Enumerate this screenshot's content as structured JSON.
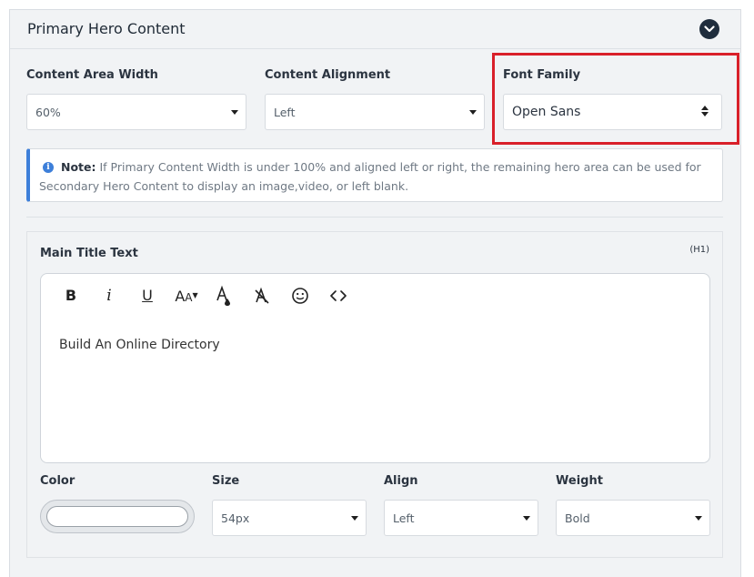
{
  "panel": {
    "title": "Primary Hero Content",
    "collapse_icon": "chevron-down-icon"
  },
  "fields": {
    "content_width": {
      "label": "Content Area Width",
      "value": "60%"
    },
    "content_alignment": {
      "label": "Content Alignment",
      "value": "Left"
    },
    "font_family": {
      "label": "Font Family",
      "value": "Open Sans"
    }
  },
  "note": {
    "label": "Note:",
    "text": "If Primary Content Width is under 100% and aligned left or right, the remaining hero area can be used for Secondary Hero Content to display an image,video, or left blank.",
    "icon": "info-icon",
    "accent": "#3d7fd9"
  },
  "highlight_color": "#d9202a",
  "main_title": {
    "label": "Main Title Text",
    "tag": "(H1)",
    "toolbar": [
      {
        "name": "bold",
        "glyph": "B"
      },
      {
        "name": "italic",
        "glyph": "i"
      },
      {
        "name": "underline",
        "glyph": "U"
      },
      {
        "name": "font-size",
        "glyph": "AA"
      },
      {
        "name": "text-color",
        "glyph": "A"
      },
      {
        "name": "clear-format",
        "glyph": "A"
      },
      {
        "name": "emoji",
        "glyph": "☺"
      },
      {
        "name": "code",
        "glyph": "<>"
      }
    ],
    "content": "Build An Online Directory"
  },
  "style_fields": {
    "color": {
      "label": "Color",
      "value": ""
    },
    "size": {
      "label": "Size",
      "value": "54px"
    },
    "align": {
      "label": "Align",
      "value": "Left"
    },
    "weight": {
      "label": "Weight",
      "value": "Bold"
    }
  }
}
